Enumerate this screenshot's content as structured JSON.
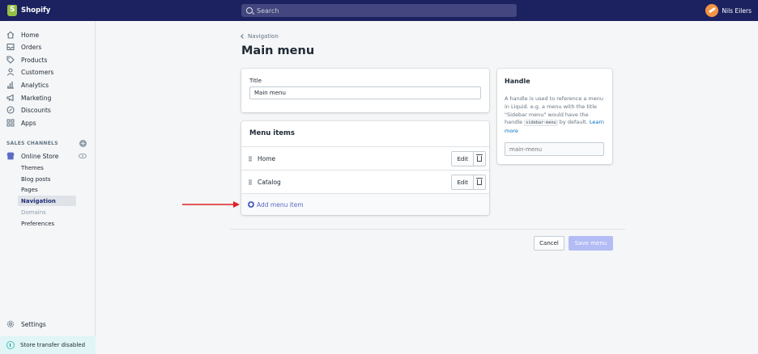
{
  "topbar": {
    "brand": "Shopify",
    "search_placeholder": "Search",
    "user_name": "Nils Eilers"
  },
  "sidebar": {
    "items": [
      {
        "label": "Home",
        "icon": "home-icon"
      },
      {
        "label": "Orders",
        "icon": "orders-icon"
      },
      {
        "label": "Products",
        "icon": "tag-icon"
      },
      {
        "label": "Customers",
        "icon": "person-icon"
      },
      {
        "label": "Analytics",
        "icon": "chart-icon"
      },
      {
        "label": "Marketing",
        "icon": "megaphone-icon"
      },
      {
        "label": "Discounts",
        "icon": "discount-icon"
      },
      {
        "label": "Apps",
        "icon": "apps-icon"
      }
    ],
    "sales_channels_label": "SALES CHANNELS",
    "online_store": "Online Store",
    "sub_items": [
      "Themes",
      "Blog posts",
      "Pages",
      "Navigation",
      "Domains",
      "Preferences"
    ],
    "active_sub_item": "Navigation",
    "settings": "Settings",
    "store_transfer": "Store transfer disabled"
  },
  "main": {
    "breadcrumb": "Navigation",
    "title": "Main menu",
    "title_card": {
      "label": "Title",
      "value": "Main menu"
    },
    "menu_card": {
      "heading": "Menu items",
      "items": [
        "Home",
        "Catalog"
      ],
      "edit_label": "Edit",
      "add_label": "Add menu item"
    },
    "handle_card": {
      "title": "Handle",
      "desc_part1": "A handle is used to reference a menu in Liquid. e.g. a menu with the title \"Sidebar menu\" would have the handle ",
      "desc_code": "sidebar-menu",
      "desc_part2": " by default. ",
      "learn_more": "Learn more",
      "placeholder": "main-menu"
    },
    "cancel_label": "Cancel",
    "save_label": "Save menu"
  },
  "colors": {
    "topbar": "#1c2260",
    "accent": "#5c6ac4",
    "primary_disabled": "#b3bcf5",
    "annotation_arrow": "#e02020"
  }
}
